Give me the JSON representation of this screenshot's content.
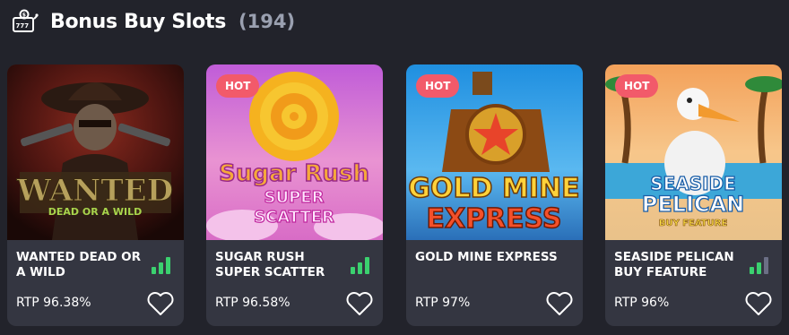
{
  "header": {
    "title": "Bonus Buy Slots",
    "count": "(194)"
  },
  "colors": {
    "background": "#22232b",
    "card": "#343641",
    "hot": "#f25a6a",
    "signal_on": "#3bd16f",
    "signal_off": "#6b6f85"
  },
  "games": [
    {
      "name": "WANTED DEAD OR A WILD",
      "rtp": "RTP 96.38%",
      "hot": false,
      "hot_label": "",
      "signal_bars": 3,
      "art_text": [
        "WANTED",
        "DEAD OR A WILD"
      ]
    },
    {
      "name": "SUGAR RUSH SUPER SCATTER",
      "rtp": "RTP 96.58%",
      "hot": true,
      "hot_label": "HOT",
      "signal_bars": 3,
      "art_text": [
        "Sugar Rush",
        "SUPER",
        "SCATTER"
      ]
    },
    {
      "name": "GOLD MINE EXPRESS",
      "rtp": "RTP 97%",
      "hot": true,
      "hot_label": "HOT",
      "signal_bars": 0,
      "art_text": [
        "GOLD MINE",
        "EXPRESS"
      ]
    },
    {
      "name": "SEASIDE PELICAN BUY FEATURE",
      "rtp": "RTP 96%",
      "hot": true,
      "hot_label": "HOT",
      "signal_bars": 2,
      "art_text": [
        "SEASIDE",
        "PELICAN",
        "BUY FEATURE"
      ]
    }
  ]
}
